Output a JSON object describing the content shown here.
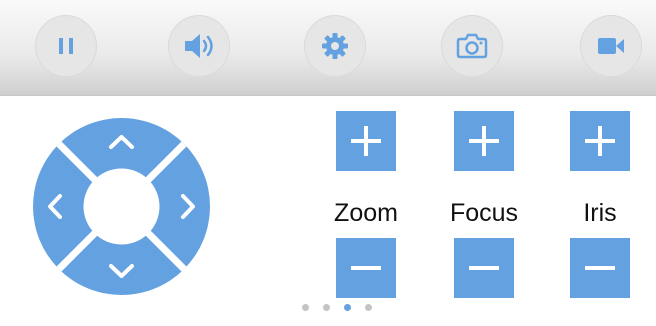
{
  "toolbar": {
    "buttons": [
      {
        "icon": "pause-icon"
      },
      {
        "icon": "volume-icon"
      },
      {
        "icon": "gear-icon"
      },
      {
        "icon": "camera-icon"
      },
      {
        "icon": "video-camera-icon"
      }
    ]
  },
  "dpad": {
    "directions": [
      "up",
      "down",
      "left",
      "right"
    ],
    "color": "#63a1e0"
  },
  "controls": [
    {
      "label": "Zoom"
    },
    {
      "label": "Focus"
    },
    {
      "label": "Iris"
    }
  ],
  "pager": {
    "count": 4,
    "active_index": 2
  },
  "colors": {
    "accent": "#63a1e0",
    "toolbar_button": "#e6e6e6",
    "icon": "#63a1e0"
  }
}
